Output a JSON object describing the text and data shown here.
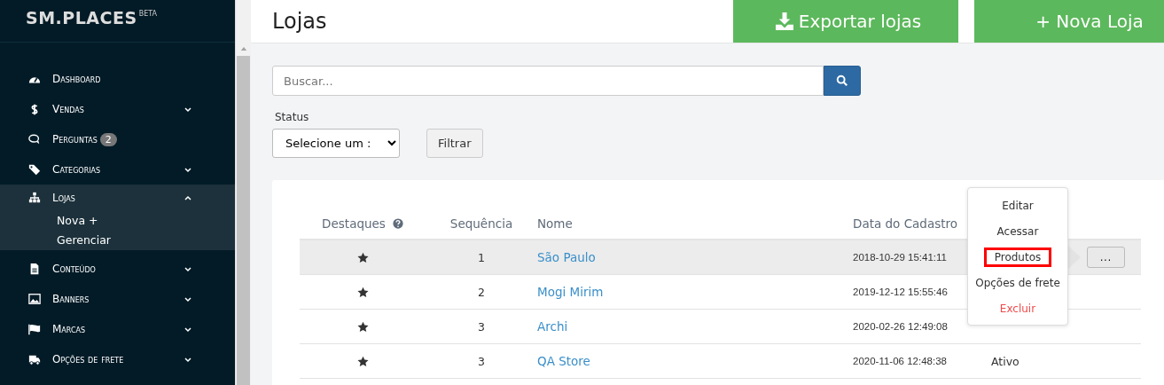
{
  "brand": {
    "logo": "SM.PLACES",
    "tag": "BETA"
  },
  "sidebar": {
    "items": [
      {
        "label": "Dashboard",
        "selected": false
      },
      {
        "label": "Vendas",
        "selected": false,
        "expanded": false
      },
      {
        "label": "Perguntas",
        "selected": false,
        "badge": "2"
      },
      {
        "label": "Categorias",
        "selected": false,
        "expanded": false
      },
      {
        "label": "Lojas",
        "selected": true,
        "expanded": true,
        "children": [
          {
            "label": "Nova +"
          },
          {
            "label": "Gerenciar"
          }
        ]
      },
      {
        "label": "Conteúdo",
        "selected": false,
        "expanded": false
      },
      {
        "label": "Banners",
        "selected": false,
        "expanded": false
      },
      {
        "label": "Marcas",
        "selected": false,
        "expanded": false
      },
      {
        "label": "Opções de frete",
        "selected": false,
        "expanded": false
      }
    ]
  },
  "header": {
    "title": "Lojas",
    "buttons": [
      {
        "label": "Exportar lojas"
      },
      {
        "label": "+ Nova Loja"
      }
    ]
  },
  "search": {
    "placeholder": "Buscar..."
  },
  "filter": {
    "label": "Status",
    "select": "Selecione um :",
    "button": "Filtrar"
  },
  "table": {
    "columns": [
      "Destaques",
      "Sequência",
      "Nome",
      "Data do Cadastro"
    ],
    "rows": [
      {
        "starred": true,
        "sequence": "1",
        "name": "São Paulo",
        "date": "2018-10-29 15:41:11",
        "selected": true,
        "actions": "..."
      },
      {
        "starred": true,
        "sequence": "2",
        "name": "Mogi Mirim",
        "date": "2019-12-12 15:55:46",
        "selected": false
      },
      {
        "starred": true,
        "sequence": "3",
        "name": "Archi",
        "date": "2020-02-26 12:49:08",
        "selected": false
      },
      {
        "starred": true,
        "sequence": "3",
        "name": "QA Store",
        "date": "2020-11-06 12:48:38",
        "status": "Ativo",
        "selected": false
      }
    ]
  },
  "menu": {
    "items": [
      {
        "label": "Editar",
        "danger": false,
        "highlighted": false
      },
      {
        "label": "Acessar",
        "danger": false,
        "highlighted": false
      },
      {
        "label": "Produtos",
        "danger": false,
        "highlighted": true
      },
      {
        "label": "Opções de frete",
        "danger": false,
        "highlighted": false
      },
      {
        "label": "Excluir",
        "danger": true,
        "highlighted": false
      }
    ]
  }
}
